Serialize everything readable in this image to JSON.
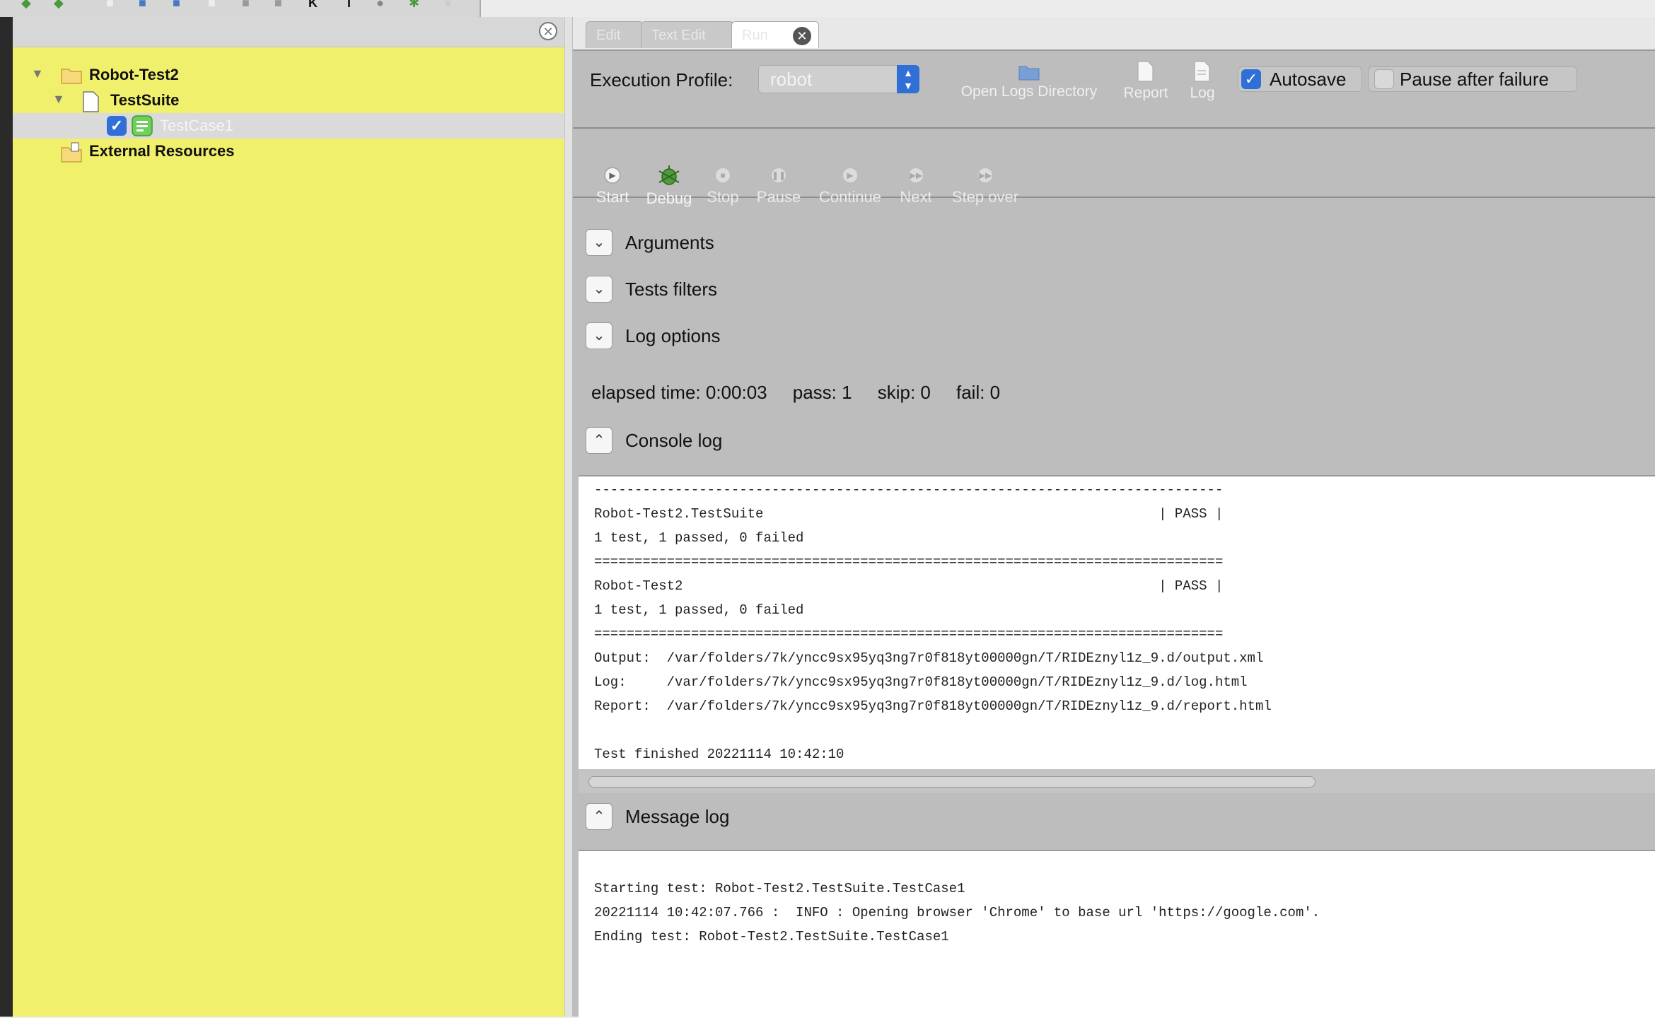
{
  "tree": {
    "items": [
      {
        "label": "Robot-Test2"
      },
      {
        "label": "TestSuite"
      },
      {
        "label": "TestCase1"
      },
      {
        "label": "External Resources"
      }
    ]
  },
  "tabs": [
    {
      "label": "Edit"
    },
    {
      "label": "Text Edit"
    },
    {
      "label": "Run"
    }
  ],
  "profile": {
    "label": "Execution Profile:",
    "value": "robot"
  },
  "toolbar": {
    "open_logs": "Open Logs Directory",
    "report": "Report",
    "log": "Log",
    "autosave": "Autosave",
    "autosave_checked": true,
    "pause_after_failure": "Pause after failure",
    "pause_after_failure_checked": false
  },
  "run_controls": [
    {
      "label": "Start"
    },
    {
      "label": "Debug"
    },
    {
      "label": "Stop"
    },
    {
      "label": "Pause"
    },
    {
      "label": "Continue"
    },
    {
      "label": "Next"
    },
    {
      "label": "Step over"
    }
  ],
  "sections": {
    "arguments": "Arguments",
    "tests_filters": "Tests filters",
    "log_options": "Log options",
    "console_log": "Console log",
    "message_log": "Message log"
  },
  "stats": {
    "elapsed": "elapsed time: 0:00:03",
    "pass": "pass: 1",
    "skip": "skip: 0",
    "fail": "fail: 0"
  },
  "console_log": [
    "------------------------------------------------------------------------------",
    "Robot-Test2.TestSuite                                                 | PASS |",
    "1 test, 1 passed, 0 failed",
    "==============================================================================",
    "Robot-Test2                                                           | PASS |",
    "1 test, 1 passed, 0 failed",
    "==============================================================================",
    "Output:  /var/folders/7k/yncc9sx95yq3ng7r0f818yt00000gn/T/RIDEznyl1z_9.d/output.xml",
    "Log:     /var/folders/7k/yncc9sx95yq3ng7r0f818yt00000gn/T/RIDEznyl1z_9.d/log.html",
    "Report:  /var/folders/7k/yncc9sx95yq3ng7r0f818yt00000gn/T/RIDEznyl1z_9.d/report.html",
    "",
    "Test finished 20221114 10:42:10"
  ],
  "message_log": [
    "Starting test: Robot-Test2.TestSuite.TestCase1",
    "20221114 10:42:07.766 :  INFO : Opening browser 'Chrome' to base url 'https://google.com'.",
    "Ending test: Robot-Test2.TestSuite.TestCase1"
  ]
}
